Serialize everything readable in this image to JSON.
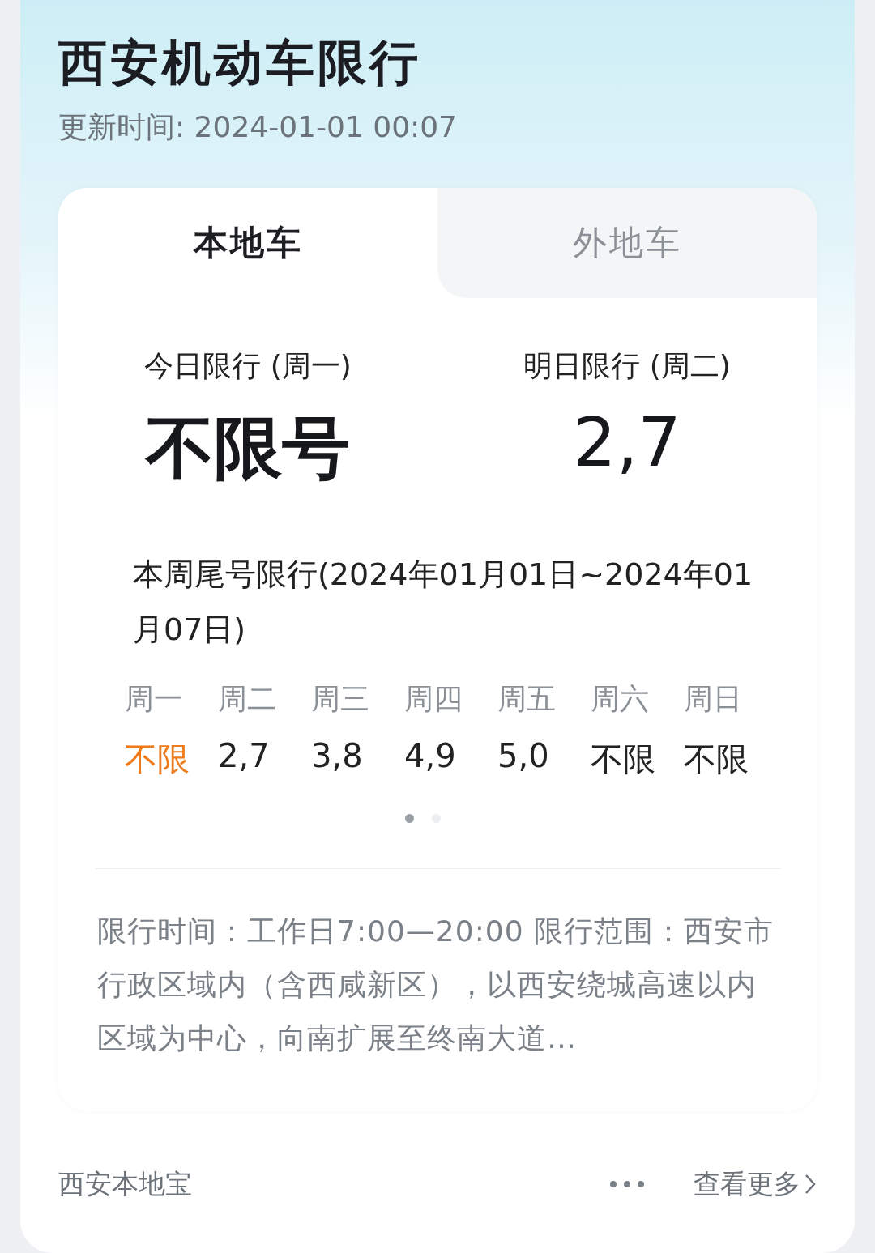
{
  "header": {
    "title": "西安机动车限行",
    "updated": "更新时间: 2024-01-01 00:07"
  },
  "tabs": [
    {
      "label": "本地车",
      "selected": true
    },
    {
      "label": "外地车",
      "selected": false
    }
  ],
  "today": {
    "label": "今日限行 (周一)",
    "value": "不限号"
  },
  "tomorrow": {
    "label": "明日限行 (周二)",
    "value": "2,7"
  },
  "week": {
    "title": "本周尾号限行(2024年01月01日~2024年01月07日)",
    "days": [
      {
        "day": "周一",
        "plates": "不限",
        "today": true
      },
      {
        "day": "周二",
        "plates": "2,7",
        "today": false
      },
      {
        "day": "周三",
        "plates": "3,8",
        "today": false
      },
      {
        "day": "周四",
        "plates": "4,9",
        "today": false
      },
      {
        "day": "周五",
        "plates": "5,0",
        "today": false
      },
      {
        "day": "周六",
        "plates": "不限",
        "today": false
      },
      {
        "day": "周日",
        "plates": "不限",
        "today": false
      }
    ]
  },
  "pager": [
    {
      "selected": true
    },
    {
      "selected": false
    }
  ],
  "description": "限行时间：工作日7:00—20:00 限行范围：西安市行政区域内（含西咸新区），以西安绕城高速以内区域为中心，向南扩展至终南大道…",
  "footer": {
    "source": "西安本地宝",
    "more_link": "查看更多"
  }
}
